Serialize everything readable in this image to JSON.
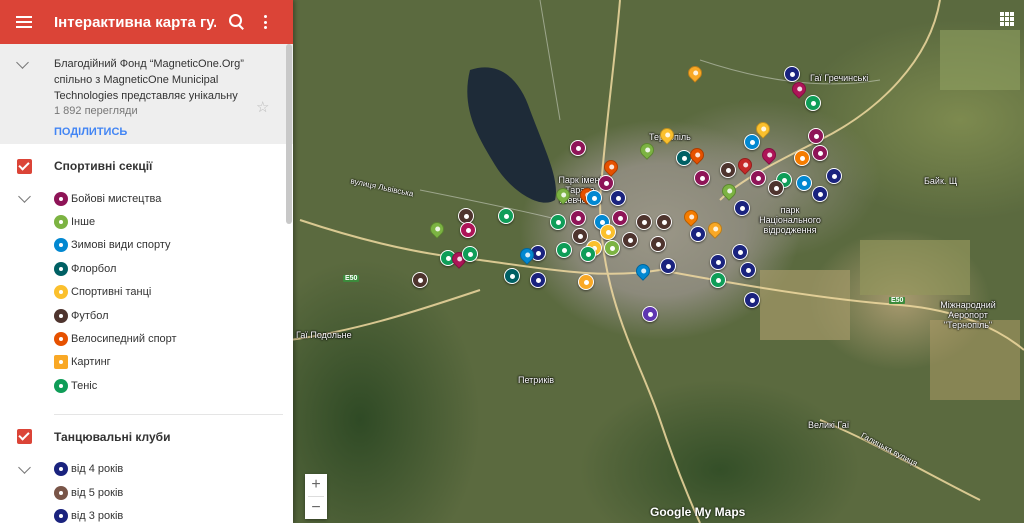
{
  "header": {
    "title": "Інтерактивна карта гу...",
    "menu_icon": "hamburger-menu-icon",
    "search_icon": "search-icon",
    "more_icon": "more-vertical-icon",
    "color": "#db4437"
  },
  "description": {
    "text": "Благодійний Фонд “MagneticOne.Org” спільно з MagneticOne Municipal Technologies представляє унікальну",
    "views": "1 892 перегляди",
    "share_label": "ПОДІЛИТИСЬ",
    "star": "☆"
  },
  "layers": [
    {
      "title": "Спортивні секції",
      "items": [
        {
          "label": "Бойові мистецтва",
          "color": "#8e1457"
        },
        {
          "label": "Інше",
          "color": "#7cb342"
        },
        {
          "label": "Зимові види спорту",
          "color": "#0288d1"
        },
        {
          "label": "Флорбол",
          "color": "#006064"
        },
        {
          "label": "Спортивні танці",
          "color": "#fbc02d"
        },
        {
          "label": "Футбол",
          "color": "#4e342e"
        },
        {
          "label": "Велосипедний спорт",
          "color": "#e65100"
        },
        {
          "label": "Картинг",
          "color": "#f9a825"
        },
        {
          "label": "Теніс",
          "color": "#0f9d58"
        }
      ]
    },
    {
      "title": "Танцювальні клуби",
      "items": [
        {
          "label": "від 4 років",
          "color": "#1a237e"
        },
        {
          "label": "від 5 років",
          "color": "#795548"
        },
        {
          "label": "від 3 років",
          "color": "#1a237e"
        }
      ]
    }
  ],
  "map": {
    "labels": {
      "ternopil": "Тернопіль",
      "park_shevchenko": "Парк імені Тараса Шевченка",
      "park_vidrodzhennia": "парк Національного відродження",
      "airport": "Міжнародний Аеропорт \"Тернопіль\"",
      "bayk": "Байк. Щ",
      "petrykiv": "Петриків",
      "velyki_hai": "Великі Гаї",
      "hai_hrechynski": "Гаї Гречинські",
      "hai_pidrodne": "Гаї Подольне",
      "lvivska": "вулиця Львівська",
      "halytska": "Галицька вулиця",
      "e50_a": "E50",
      "e50_b": "E50"
    },
    "zoom_in": "+",
    "zoom_out": "−",
    "watermark": "Google My Maps",
    "apps_icon": "apps-grid-icon"
  }
}
